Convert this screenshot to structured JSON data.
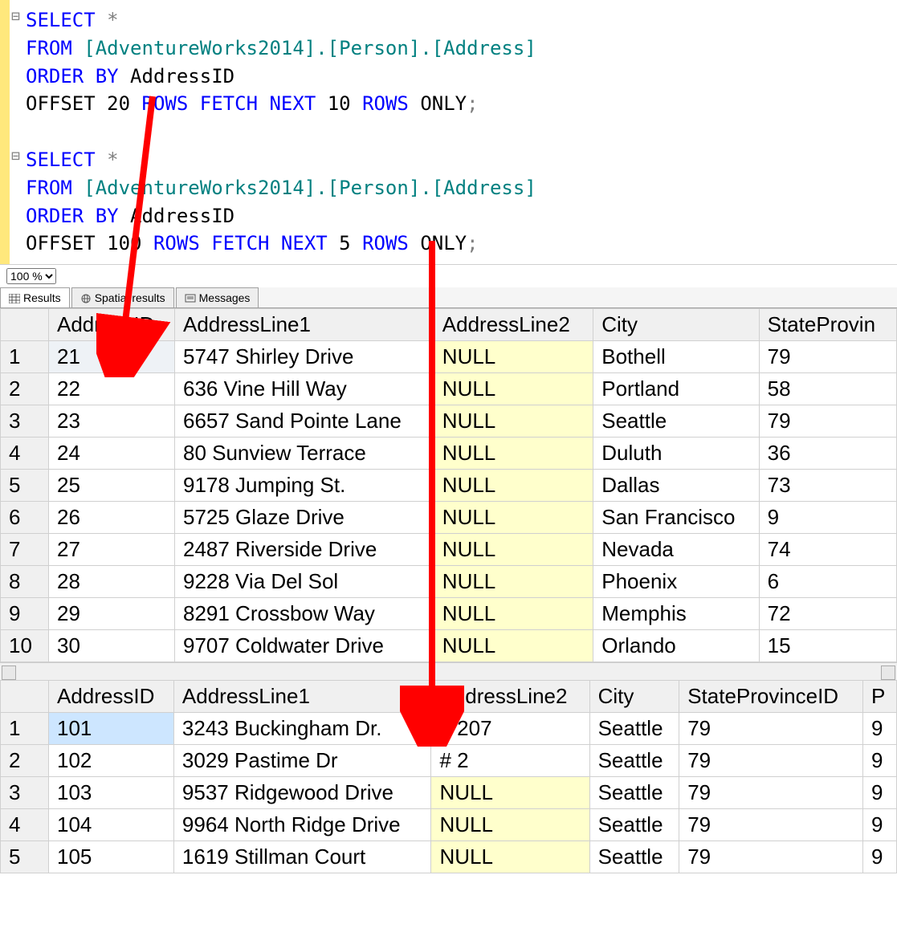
{
  "zoom": "100 %",
  "tabs": {
    "results": "Results",
    "spatial": "Spatial results",
    "messages": "Messages"
  },
  "sql": {
    "q1": {
      "l1_select": "SELECT",
      "l1_star": "*",
      "l2_from": "FROM",
      "l2_obj": "[AdventureWorks2014].[Person].[Address]",
      "l3_orderby": "ORDER BY",
      "l3_col": "AddressID",
      "l4_offset": "OFFSET",
      "l4_n1": "20",
      "l4_rows1": "ROWS",
      "l4_fetch": "FETCH",
      "l4_next": "NEXT",
      "l4_n2": "10",
      "l4_rows2": "ROWS",
      "l4_only": "ONLY",
      "l4_semi": ";"
    },
    "q2": {
      "l1_select": "SELECT",
      "l1_star": "*",
      "l2_from": "FROM",
      "l2_obj": "[AdventureWorks2014].[Person].[Address]",
      "l3_orderby": "ORDER BY",
      "l3_col": "AddressID",
      "l4_offset": "OFFSET",
      "l4_n1": "100",
      "l4_rows1": "ROWS",
      "l4_fetch": "FETCH",
      "l4_next": "NEXT",
      "l4_n2": "5",
      "l4_rows2": "ROWS",
      "l4_only": "ONLY",
      "l4_semi": ";"
    }
  },
  "grid1": {
    "headers": [
      "AddressID",
      "AddressLine1",
      "AddressLine2",
      "City",
      "StateProvin"
    ],
    "rows": [
      {
        "n": "1",
        "AddressID": "21",
        "AddressLine1": "5747 Shirley Drive",
        "AddressLine2": "NULL",
        "City": "Bothell",
        "StateProvin": "79"
      },
      {
        "n": "2",
        "AddressID": "22",
        "AddressLine1": "636 Vine Hill Way",
        "AddressLine2": "NULL",
        "City": "Portland",
        "StateProvin": "58"
      },
      {
        "n": "3",
        "AddressID": "23",
        "AddressLine1": "6657 Sand Pointe Lane",
        "AddressLine2": "NULL",
        "City": "Seattle",
        "StateProvin": "79"
      },
      {
        "n": "4",
        "AddressID": "24",
        "AddressLine1": "80 Sunview Terrace",
        "AddressLine2": "NULL",
        "City": "Duluth",
        "StateProvin": "36"
      },
      {
        "n": "5",
        "AddressID": "25",
        "AddressLine1": "9178 Jumping St.",
        "AddressLine2": "NULL",
        "City": "Dallas",
        "StateProvin": "73"
      },
      {
        "n": "6",
        "AddressID": "26",
        "AddressLine1": "5725 Glaze Drive",
        "AddressLine2": "NULL",
        "City": "San Francisco",
        "StateProvin": "9"
      },
      {
        "n": "7",
        "AddressID": "27",
        "AddressLine1": "2487 Riverside Drive",
        "AddressLine2": "NULL",
        "City": "Nevada",
        "StateProvin": "74"
      },
      {
        "n": "8",
        "AddressID": "28",
        "AddressLine1": "9228 Via Del Sol",
        "AddressLine2": "NULL",
        "City": "Phoenix",
        "StateProvin": "6"
      },
      {
        "n": "9",
        "AddressID": "29",
        "AddressLine1": "8291 Crossbow Way",
        "AddressLine2": "NULL",
        "City": "Memphis",
        "StateProvin": "72"
      },
      {
        "n": "10",
        "AddressID": "30",
        "AddressLine1": "9707 Coldwater Drive",
        "AddressLine2": "NULL",
        "City": "Orlando",
        "StateProvin": "15"
      }
    ]
  },
  "grid2": {
    "headers": [
      "AddressID",
      "AddressLine1",
      "AddressLine2",
      "City",
      "StateProvinceID",
      "P"
    ],
    "rows": [
      {
        "n": "1",
        "AddressID": "101",
        "AddressLine1": "3243 Buckingham Dr.",
        "AddressLine2": "# 207",
        "City": "Seattle",
        "StateProvinceID": "79",
        "P": "9"
      },
      {
        "n": "2",
        "AddressID": "102",
        "AddressLine1": "3029 Pastime Dr",
        "AddressLine2": "# 2",
        "City": "Seattle",
        "StateProvinceID": "79",
        "P": "9"
      },
      {
        "n": "3",
        "AddressID": "103",
        "AddressLine1": "9537 Ridgewood Drive",
        "AddressLine2": "NULL",
        "City": "Seattle",
        "StateProvinceID": "79",
        "P": "9"
      },
      {
        "n": "4",
        "AddressID": "104",
        "AddressLine1": "9964 North Ridge Drive",
        "AddressLine2": "NULL",
        "City": "Seattle",
        "StateProvinceID": "79",
        "P": "9"
      },
      {
        "n": "5",
        "AddressID": "105",
        "AddressLine1": "1619 Stillman Court",
        "AddressLine2": "NULL",
        "City": "Seattle",
        "StateProvinceID": "79",
        "P": "9"
      }
    ]
  }
}
